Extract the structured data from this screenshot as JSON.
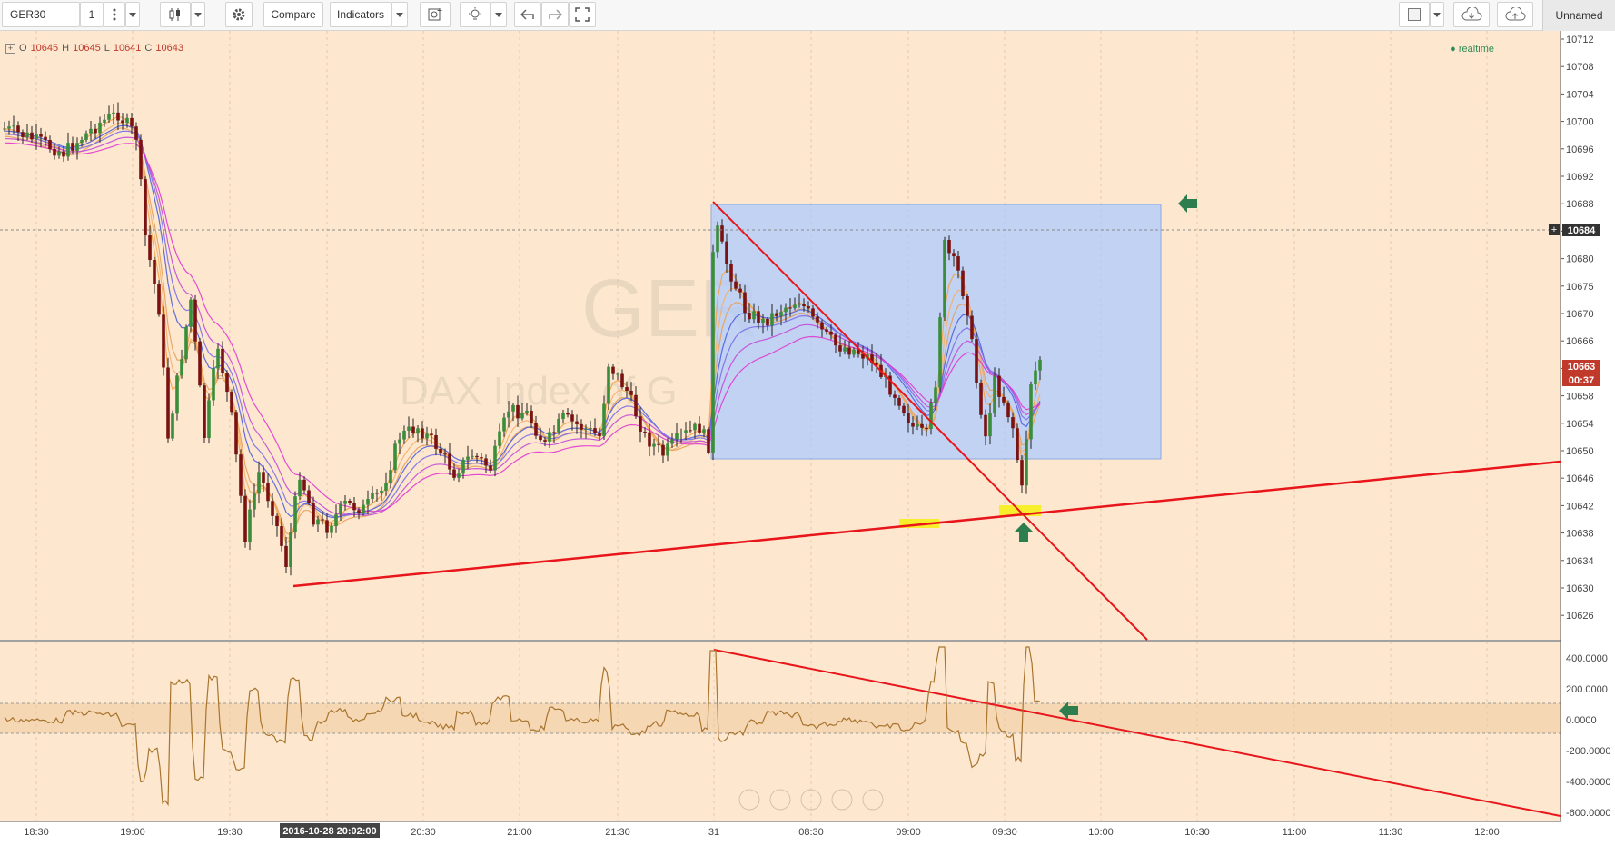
{
  "toolbar": {
    "symbol": "GER30",
    "interval": "1",
    "compare_label": "Compare",
    "indicators_label": "Indicators",
    "layout_name": "Unnamed"
  },
  "legend": {
    "o_label": "O",
    "o_value": "10645",
    "h_label": "H",
    "h_value": "10645",
    "l_label": "L",
    "l_value": "10641",
    "c_label": "C",
    "c_value": "10643"
  },
  "status": {
    "realtime": "realtime"
  },
  "watermark": {
    "symbol": "GER",
    "description": "DAX Index of G"
  },
  "price_axis": {
    "ticks": [
      "10712",
      "10708",
      "10704",
      "10700",
      "10696",
      "10692",
      "10688",
      "10684",
      "10680",
      "10675",
      "10670",
      "10666",
      "10662",
      "10658",
      "10654",
      "10650",
      "10646",
      "10642",
      "10638",
      "10634",
      "10630",
      "10626"
    ],
    "crosshair_price": "10684",
    "last_price": "10663",
    "countdown": "00:37"
  },
  "osc_axis": {
    "ticks": [
      "400.0000",
      "200.0000",
      "0.0000",
      "-200.0000",
      "-400.0000",
      "-600.0000"
    ]
  },
  "time_axis": {
    "ticks": [
      "18:30",
      "19:00",
      "19:30",
      "20:00",
      "20:30",
      "21:00",
      "21:30",
      "31",
      "08:30",
      "09:00",
      "09:30",
      "10:00",
      "10:30",
      "11:00",
      "11:30",
      "12:00"
    ],
    "crosshair_time": "2016-10-28 20:02:00"
  },
  "colors": {
    "chart_bg": "#fde8cf",
    "up_candle": "#3a8d3a",
    "down_candle": "#7a1212",
    "trendline": "#e8151b",
    "box_fill": "#aecbff",
    "arrow": "#2e7d4f",
    "highlight": "#f7f01a"
  },
  "icons": [
    "candles-icon",
    "gear-icon",
    "alert-icon",
    "bulb-icon",
    "undo-icon",
    "redo-icon",
    "fullscreen-icon",
    "square-icon",
    "cloud-download-icon",
    "cloud-upload-icon",
    "menu-dots-icon",
    "chevron-down-icon"
  ]
}
